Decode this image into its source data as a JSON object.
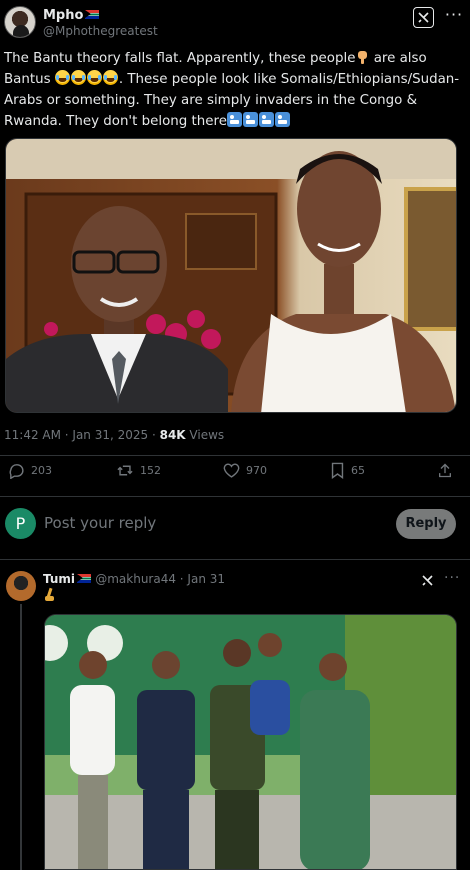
{
  "post": {
    "author_name": "Mpho",
    "author_handle": "@Mphothegreatest",
    "text_part1": "The Bantu theory falls flat. Apparently, these people",
    "text_part2": " are also Bantus ",
    "text_part3": ". These people look like Somalis/Ethiopians/Sudan-Arabs or something. They are simply invaders in the Congo & Rwanda. They don't belong there",
    "timestamp": "11:42 AM · Jan 31, 2025 · ",
    "views_count": "84K",
    "views_label": " Views",
    "icons": {
      "grok": "grok-icon",
      "more": "more-icon",
      "pointing_down": "backhand-index-pointing-down-emoji",
      "laughing": "face-with-tears-of-joy-emoji",
      "baby": "baby-symbol-emoji",
      "flag": "south-africa-flag"
    }
  },
  "actions": {
    "replies": "203",
    "reposts": "152",
    "likes": "970",
    "bookmarks": "65"
  },
  "reply_composer": {
    "avatar_initial": "P",
    "placeholder": "Post your reply",
    "button_label": "Reply"
  },
  "reply": {
    "author_name": "Tumi",
    "author_handle": "@makhura44",
    "date": " · Jan 31",
    "emoji": "giraffe-emoji"
  },
  "colors": {
    "background": "#000000",
    "text": "#e7e9ea",
    "muted": "#71767b",
    "divider": "#2f3336",
    "reply_button": "#787a7a"
  }
}
